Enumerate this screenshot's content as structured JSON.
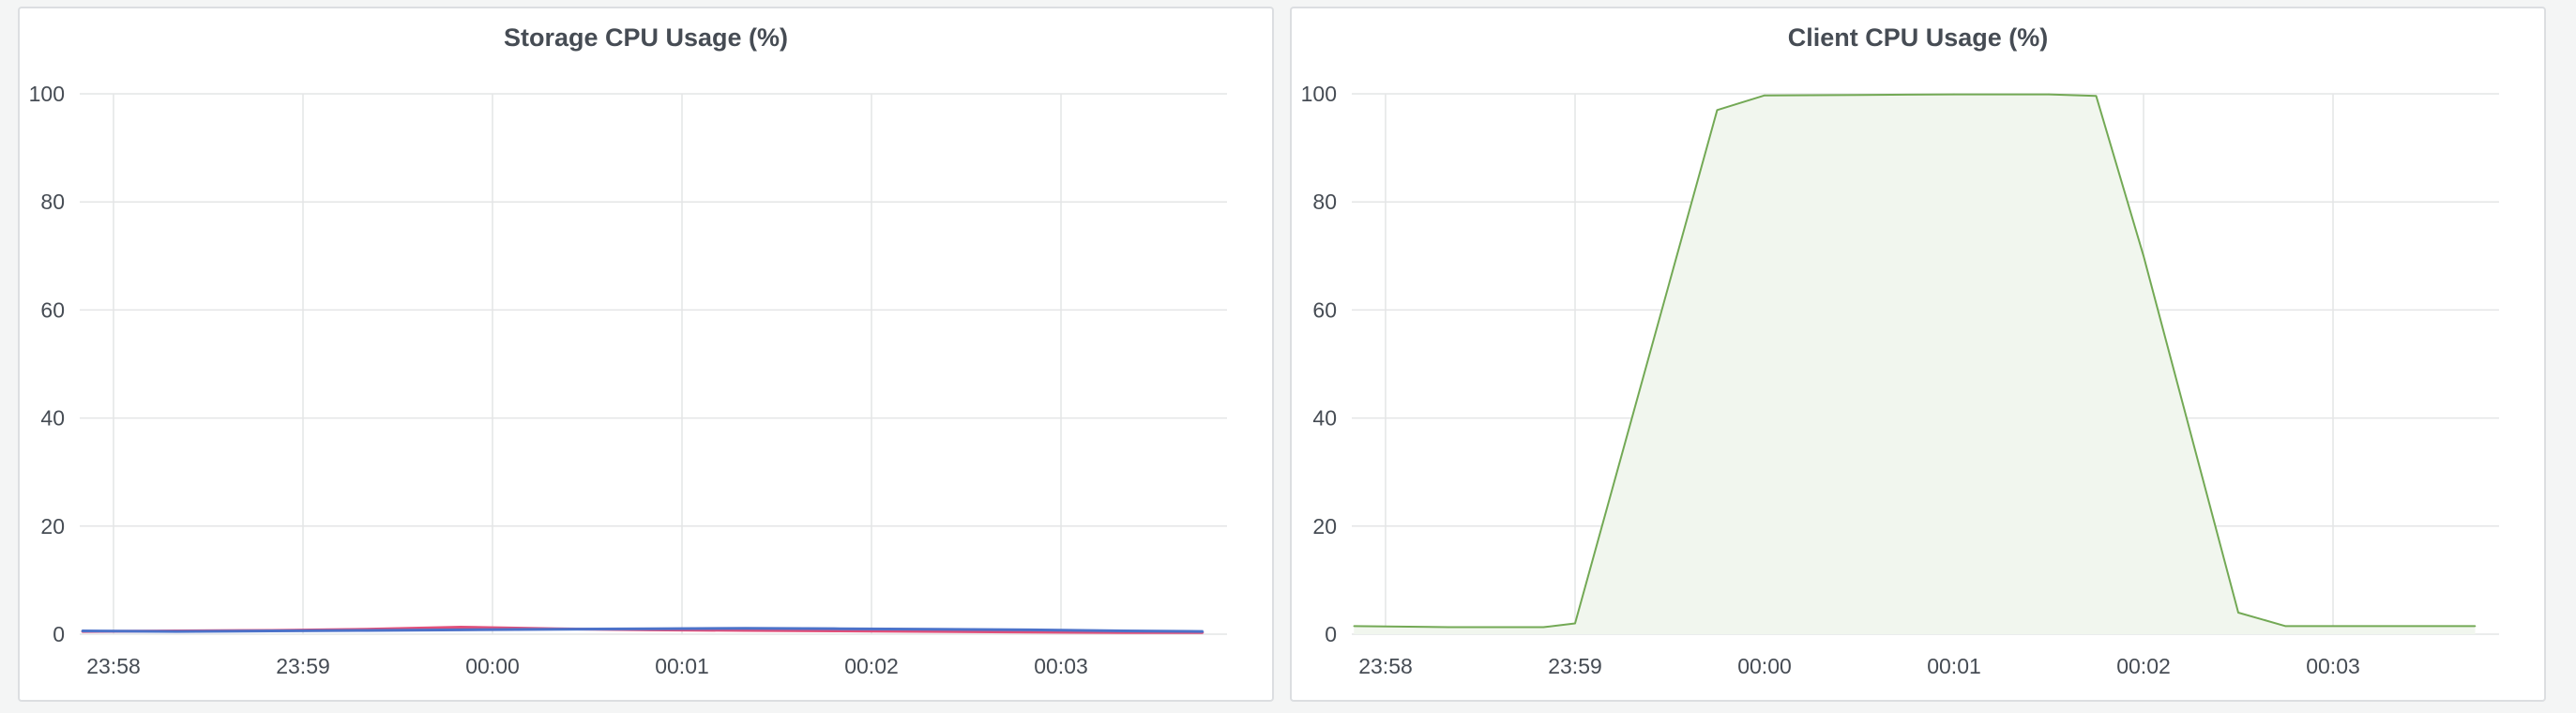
{
  "chart_data": [
    {
      "type": "line",
      "title": "Storage CPU Usage (%)",
      "ylim": [
        0,
        100
      ],
      "yticks": [
        0,
        20,
        40,
        60,
        80,
        100
      ],
      "x_tick_labels": [
        "23:58",
        "23:59",
        "00:00",
        "00:01",
        "00:02",
        "00:03"
      ],
      "grid": true,
      "x": [
        "23:57:50",
        "23:58:20",
        "23:58:50",
        "23:59:20",
        "23:59:50",
        "00:00:20",
        "00:00:50",
        "00:01:20",
        "00:01:50",
        "00:02:20",
        "00:02:50",
        "00:03:20",
        "00:03:45"
      ],
      "series": [
        {
          "color": "#e0507a",
          "values": [
            0.5,
            0.6,
            0.7,
            0.9,
            1.3,
            1.0,
            0.8,
            0.7,
            0.6,
            0.5,
            0.4,
            0.3,
            0.3
          ]
        },
        {
          "color": "#4c72c9",
          "values": [
            0.6,
            0.5,
            0.6,
            0.7,
            0.8,
            0.9,
            1.0,
            1.1,
            1.0,
            0.9,
            0.8,
            0.6,
            0.5
          ]
        }
      ]
    },
    {
      "type": "area",
      "title": "Client CPU Usage (%)",
      "ylim": [
        0,
        100
      ],
      "yticks": [
        0,
        20,
        40,
        60,
        80,
        100
      ],
      "x_tick_labels": [
        "23:58",
        "23:59",
        "00:00",
        "00:01",
        "00:02",
        "00:03"
      ],
      "grid": true,
      "x": [
        "23:57:50",
        "23:58:20",
        "23:58:50",
        "23:59:00",
        "23:59:45",
        "00:00:00",
        "00:00:30",
        "00:01:00",
        "00:01:30",
        "00:01:45",
        "00:02:00",
        "00:02:30",
        "00:02:45",
        "00:03:15",
        "00:03:45"
      ],
      "series": [
        {
          "color": "#73a955",
          "fill": "#f1f6ee",
          "values": [
            1.5,
            1.3,
            1.3,
            2.0,
            97,
            99.7,
            99.8,
            99.9,
            99.9,
            99.6,
            70,
            4,
            1.5,
            1.5,
            1.5
          ]
        }
      ]
    }
  ]
}
